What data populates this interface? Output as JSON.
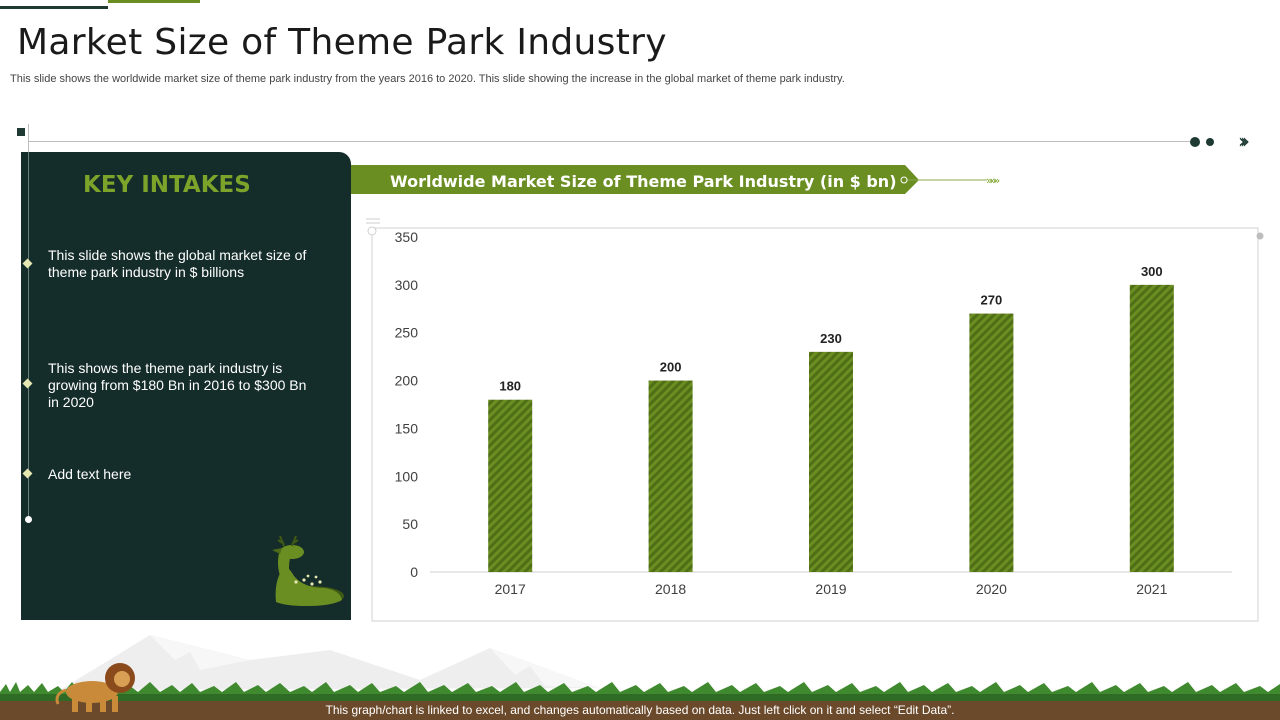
{
  "slide": {
    "title": "Market Size of Theme Park Industry",
    "subtitle": "This slide shows the worldwide market size of theme park industry from the years 2016 to 2020. This slide showing the increase in the global market of theme park industry.",
    "footer": "This graph/chart is linked to excel, and changes automatically based on data. Just left click on it and select “Edit Data”."
  },
  "key_intakes": {
    "heading": "KEY INTAKES",
    "items": [
      "This slide shows the global market size of theme park industry in $ billions",
      "This shows the theme park industry is growing from $180 Bn in 2016 to $300 Bn in 2020",
      "Add text here"
    ]
  },
  "chart_banner": {
    "title": "Worldwide Market Size of Theme Park Industry (in $ bn)"
  },
  "colors": {
    "dark_green": "#142c2a",
    "accent_green": "#6b8e23",
    "bar_green": "#5c7c17"
  },
  "icons": {
    "panel": "deer-icon",
    "ground": "lion-icon"
  },
  "chart_data": {
    "type": "bar",
    "title": "Worldwide Market Size of Theme Park Industry (in $ bn)",
    "categories": [
      "2017",
      "2018",
      "2019",
      "2020",
      "2021"
    ],
    "values": [
      180,
      200,
      230,
      270,
      300
    ],
    "data_labels": [
      "180",
      "200",
      "230",
      "270",
      "300"
    ],
    "ylim": [
      0,
      350
    ],
    "yticks": [
      0,
      50,
      100,
      150,
      200,
      250,
      300,
      350
    ],
    "xlabel": "",
    "ylabel": "",
    "grid": false,
    "legend": "none"
  }
}
